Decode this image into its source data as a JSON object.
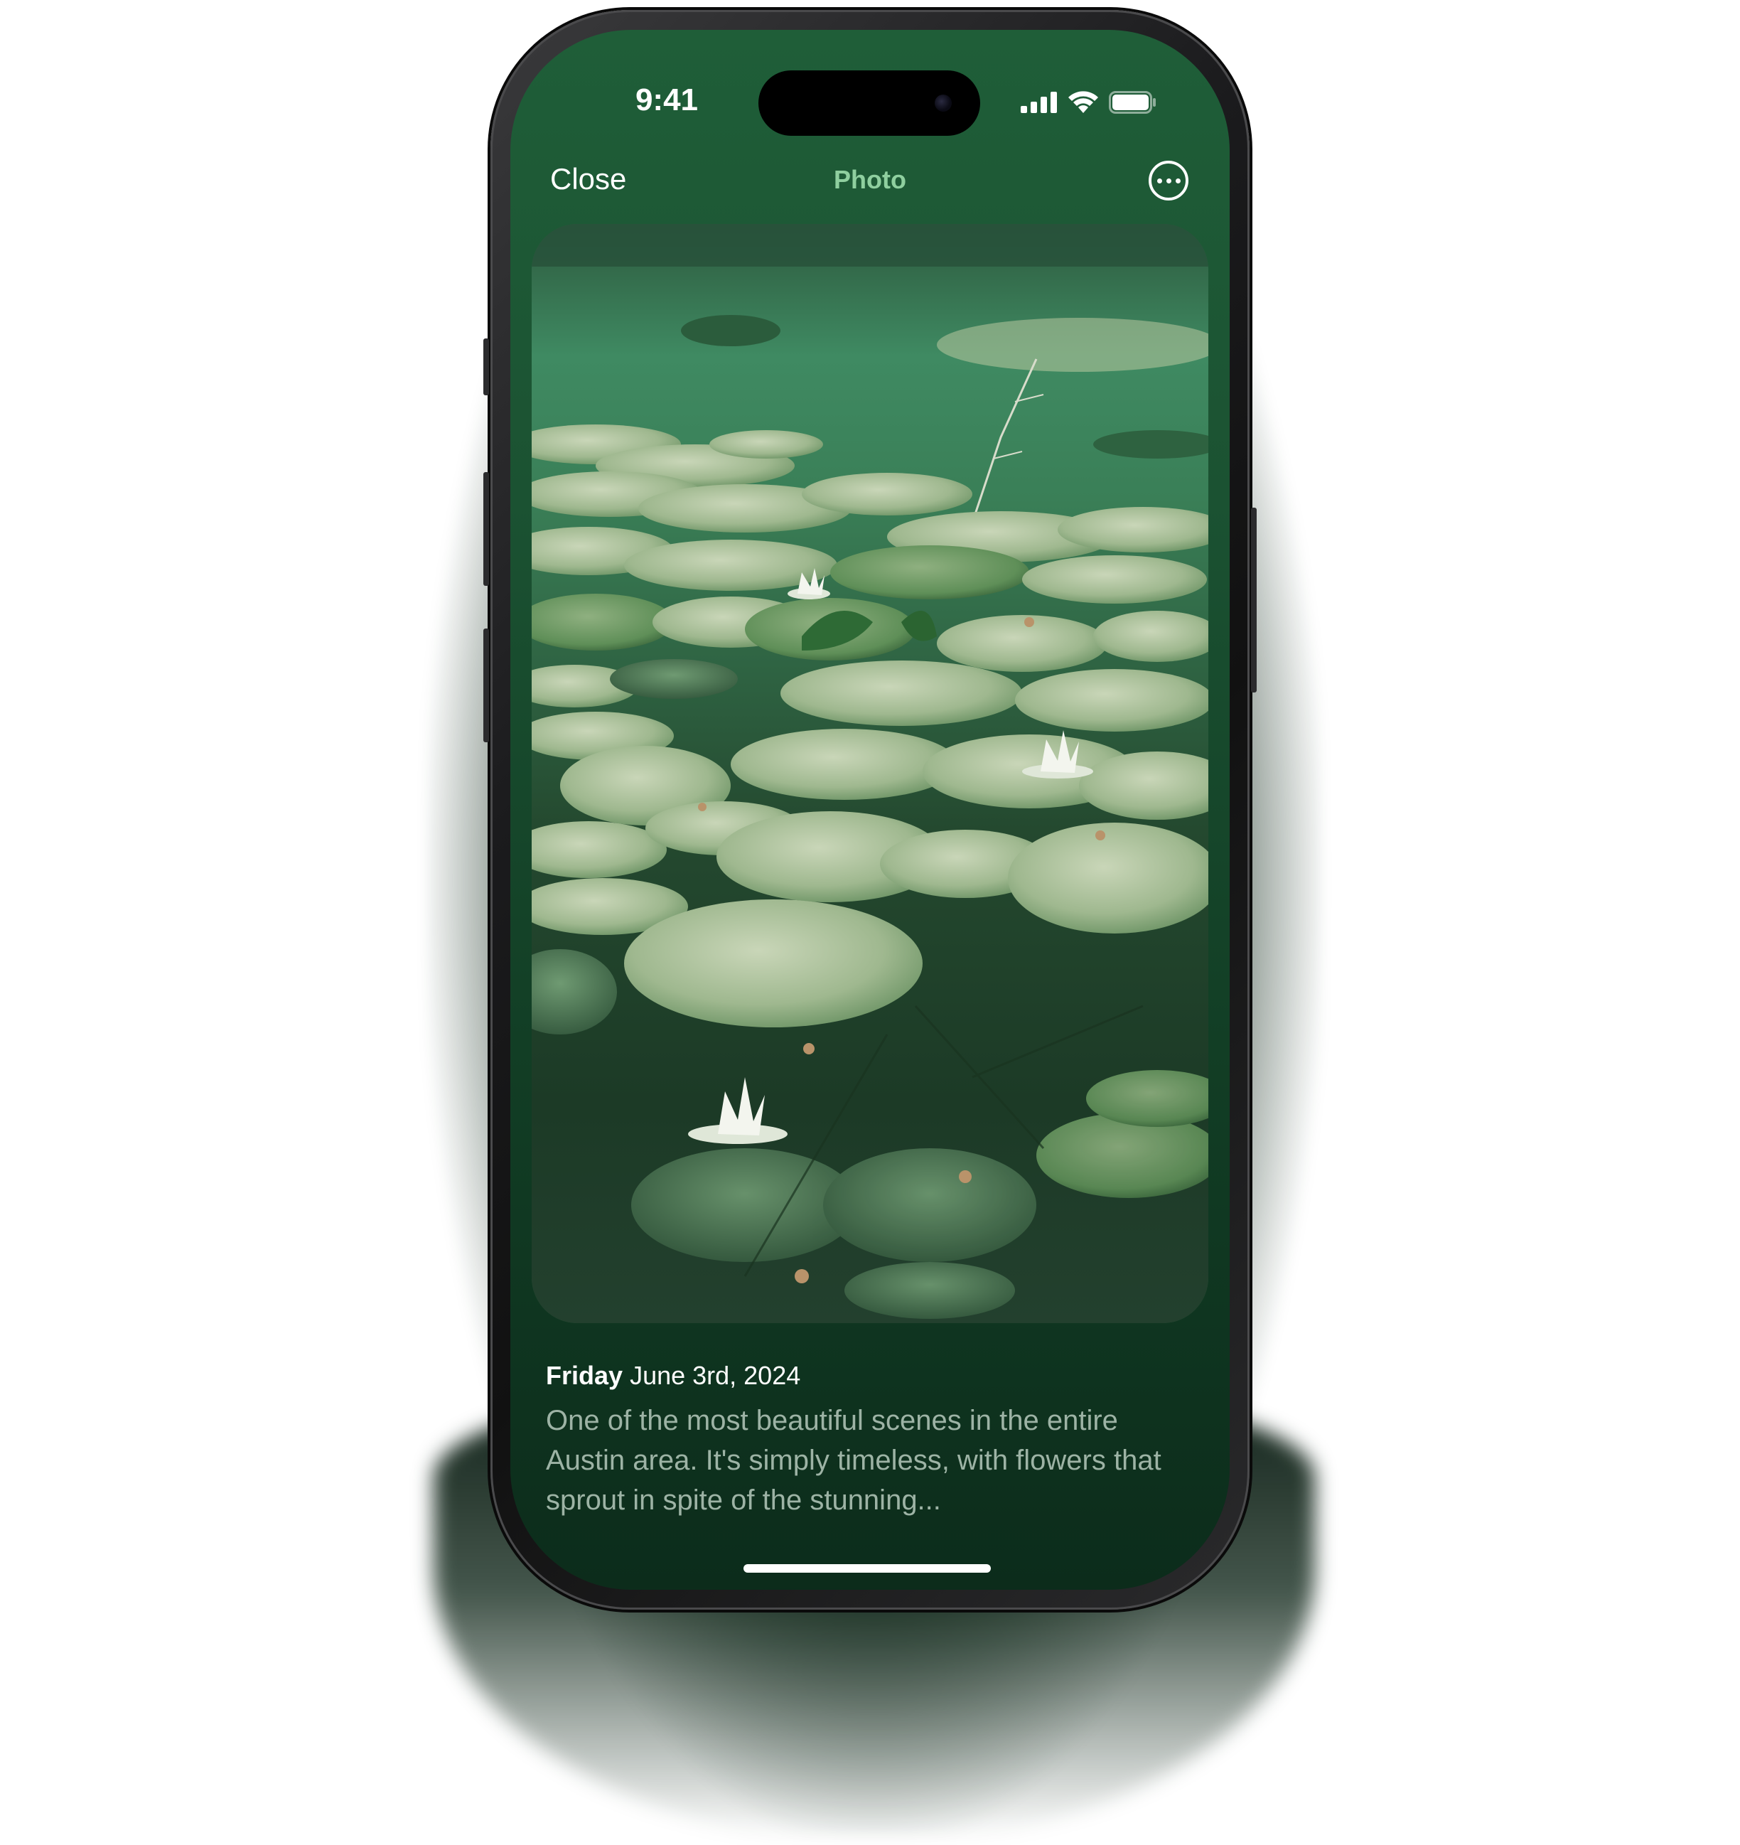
{
  "status_bar": {
    "time": "9:41",
    "icons": [
      "cellular-signal-icon",
      "wifi-icon",
      "battery-icon"
    ]
  },
  "nav": {
    "close_label": "Close",
    "title": "Photo",
    "more_icon": "ellipsis-circle-icon"
  },
  "photo": {
    "subject": "pond-with-water-lilies"
  },
  "caption": {
    "weekday": "Friday",
    "date": "June 3rd, 2024",
    "body": "One of the most beautiful scenes in the entire Austin area. It's simply timeless, with flowers that sprout in spite of the stunning..."
  },
  "colors": {
    "screen_top": "#1f5e38",
    "screen_bottom": "#0c2c1b",
    "title_accent": "#8fcf9f",
    "caption_text": "#9db3a5"
  }
}
